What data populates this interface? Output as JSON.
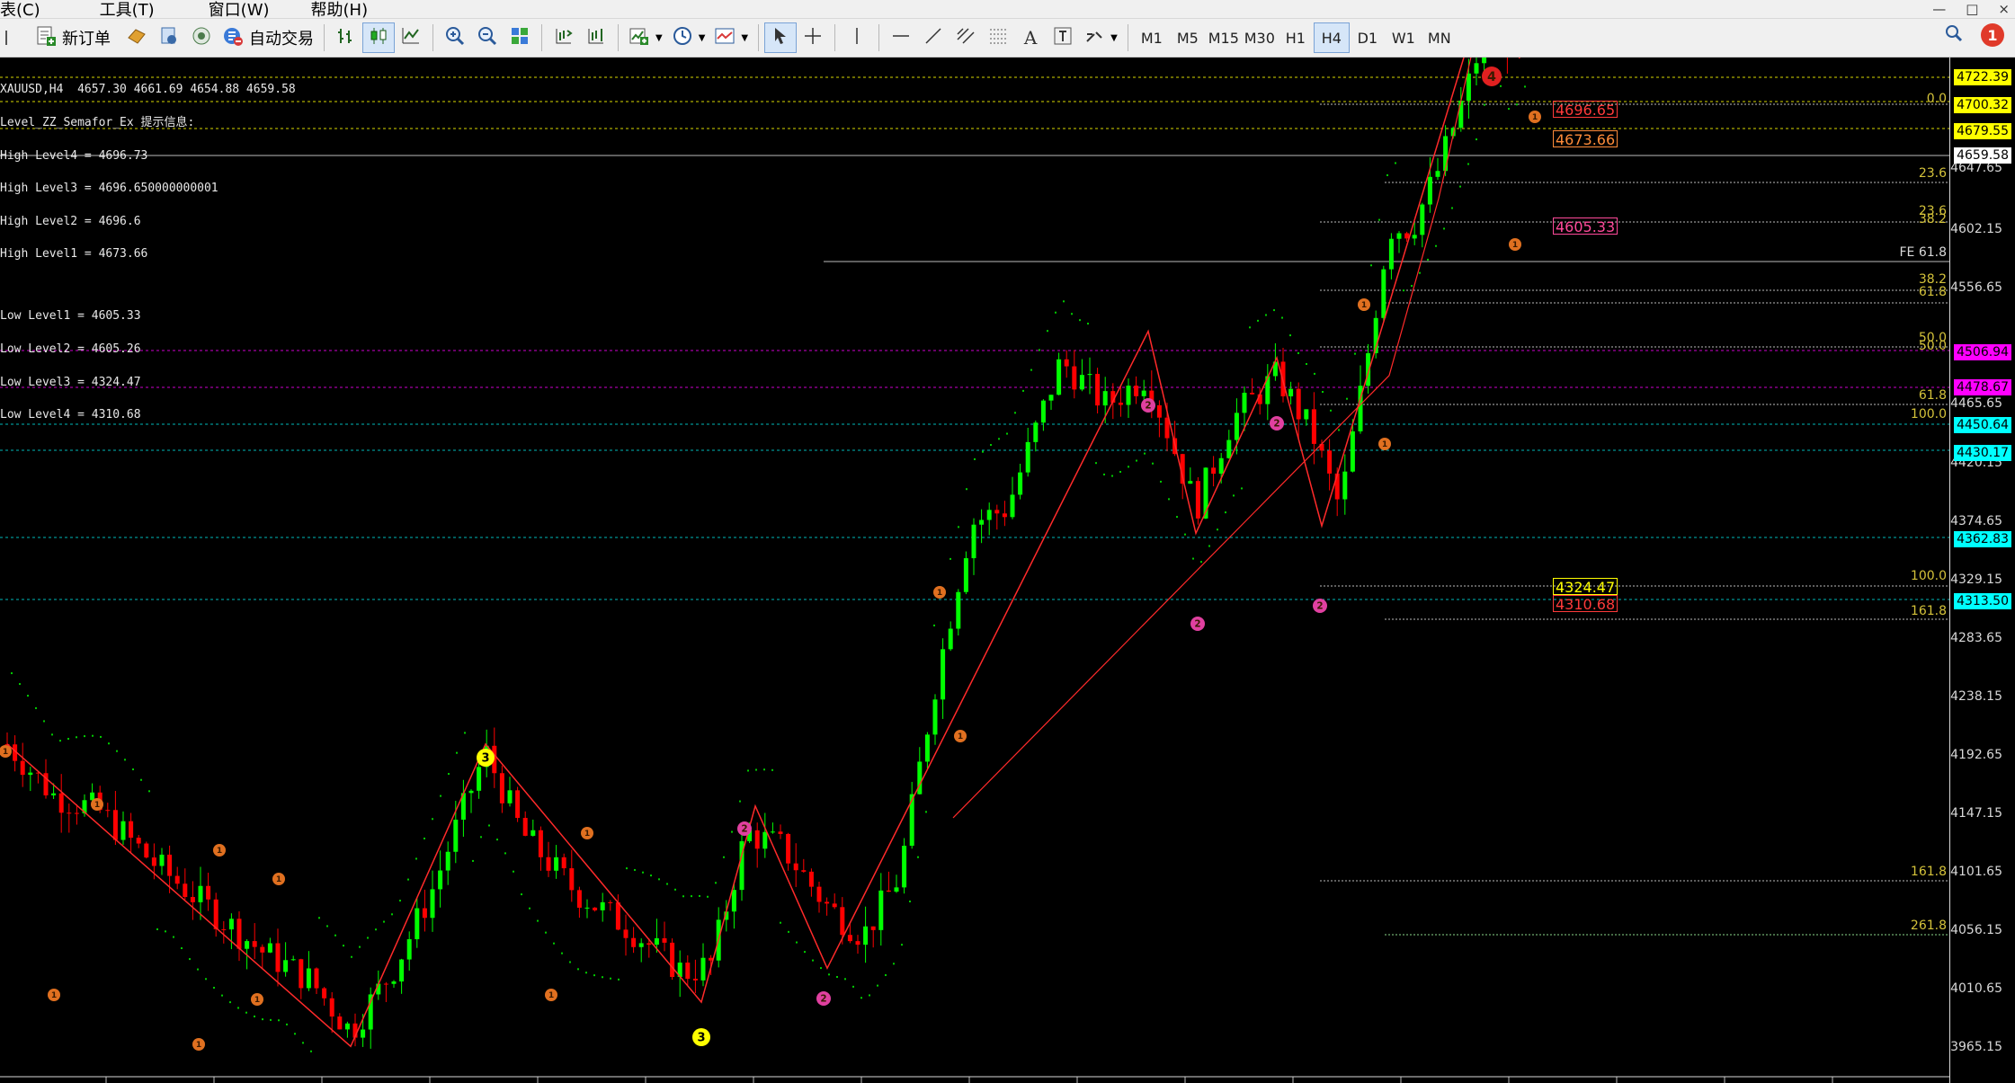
{
  "menu": {
    "items": [
      "表(C)",
      "工具(T)",
      "窗口(W)",
      "帮助(H)"
    ],
    "window_controls": [
      "—",
      "□",
      "×"
    ]
  },
  "toolbar": {
    "new_order_label": "新订单",
    "auto_trade_label": "自动交易",
    "timeframes": [
      "M1",
      "M5",
      "M15",
      "M30",
      "H1",
      "H4",
      "D1",
      "W1",
      "MN"
    ],
    "active_timeframe": "H4",
    "notification_count": "1",
    "icons": [
      "new-order-icon",
      "strategy-icon",
      "market-watch-icon",
      "signals-icon",
      "auto-trade-icon",
      "bar-chart-icon",
      "candlestick-icon",
      "line-chart-icon",
      "zoom-in-icon",
      "zoom-out-icon",
      "tile-windows-icon",
      "autoscroll-icon",
      "chart-shift-icon",
      "indicators-icon",
      "periods-icon",
      "templates-icon",
      "cursor-icon",
      "crosshair-icon",
      "vertical-line-icon",
      "horizontal-line-icon",
      "trendline-icon",
      "equidistant-channel-icon",
      "fibonacci-icon",
      "text-icon",
      "text-label-icon",
      "arrows-icon",
      "search-icon"
    ]
  },
  "chart": {
    "symbol_line": "XAUUSD,H4  4657.30 4661.69 4654.88 4659.58",
    "indicator_lines": [
      "Level_ZZ_Semafor_Ex 提示信息:",
      "High Level4 = 4696.73",
      "High Level3 = 4696.650000000001",
      "High Level2 = 4696.6",
      "High Level1 = 4673.66",
      "Low Level1 = 4605.33",
      "Low Level2 = 4605.26",
      "Low Level3 = 4324.47",
      "Low Level4 = 4310.68"
    ],
    "price_axis_labels": [
      "4647.65",
      "4602.15",
      "4556.65",
      "4465.65",
      "4420.15",
      "4374.65",
      "4329.15",
      "4283.65",
      "4238.15",
      "4192.65",
      "4147.15",
      "4101.65",
      "4056.15",
      "4010.65",
      "3965.15"
    ],
    "price_tags": [
      {
        "text": "4722.39",
        "bg": "#ffff00",
        "fg": "#000000"
      },
      {
        "text": "4700.32",
        "bg": "#ffff00",
        "fg": "#000000"
      },
      {
        "text": "4679.55",
        "bg": "#ffff00",
        "fg": "#000000"
      },
      {
        "text": "4659.58",
        "bg": "#ffffff",
        "fg": "#000000"
      },
      {
        "text": "4506.94",
        "bg": "#ff00ff",
        "fg": "#000000"
      },
      {
        "text": "4478.67",
        "bg": "#ff00ff",
        "fg": "#000000"
      },
      {
        "text": "4450.64",
        "bg": "#00ffff",
        "fg": "#000000"
      },
      {
        "text": "4430.17",
        "bg": "#00ffff",
        "fg": "#000000"
      },
      {
        "text": "4362.83",
        "bg": "#00ffff",
        "fg": "#000000"
      },
      {
        "text": "4313.50",
        "bg": "#00ffff",
        "fg": "#000000"
      }
    ],
    "level_boxes": [
      {
        "text": "4696.65",
        "color": "#ff3a3a"
      },
      {
        "text": "4673.66",
        "color": "#ff8c3a"
      },
      {
        "text": "4605.33",
        "color": "#ff4a9a"
      },
      {
        "text": "4324.47",
        "color": "#ffff00"
      },
      {
        "text": "4310.68",
        "color": "#ff3a3a"
      }
    ],
    "fib_labels": [
      "0.0",
      "23.6",
      "23.6",
      "38.2",
      "FE 61.8",
      "50.0",
      "38.2",
      "61.8",
      "50.0",
      "61.8",
      "100.0",
      "100.0",
      "161.8",
      "161.8",
      "261.8"
    ],
    "semafor_labels": [
      "1",
      "2",
      "3",
      "4"
    ],
    "colors": {
      "bull": "#00ff00",
      "bear": "#ff0000",
      "zigzag": "#ff2a2a",
      "sar": "#00cc00"
    }
  }
}
